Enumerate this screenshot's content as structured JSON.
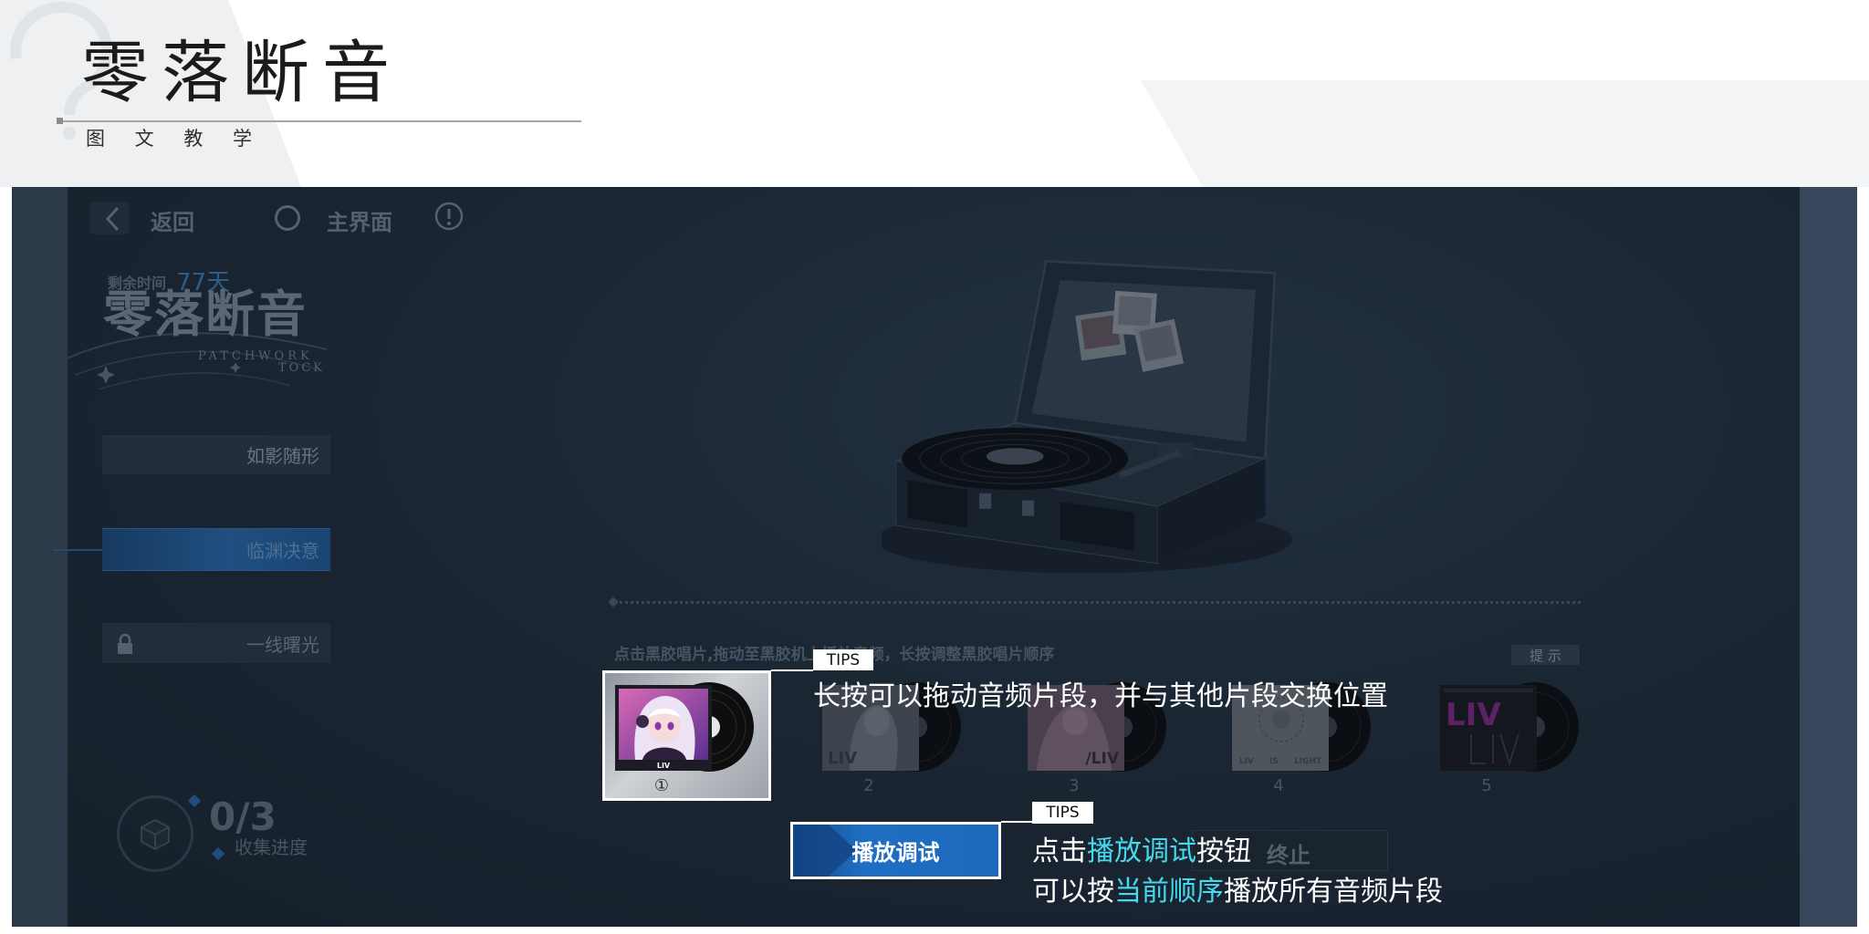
{
  "header": {
    "title": "零落断音",
    "subtitle": "图 文 教 学"
  },
  "game": {
    "nav": {
      "back_label": "返回",
      "home_label": "主界面"
    },
    "timer": {
      "label": "剩余时间",
      "value": "77天"
    },
    "logo": {
      "title": "零落断音",
      "sub1": "PATCHWORK",
      "sub2": "TOCK"
    },
    "menu": [
      {
        "label": "如影随形",
        "state": "normal"
      },
      {
        "label": "临渊决意",
        "state": "selected"
      },
      {
        "label": "一线曙光",
        "state": "locked"
      }
    ],
    "progress": {
      "value": "0/3",
      "label": "收集进度"
    },
    "instruction": "点击黑胶唱片,拖动至黑胶机上播放音频，长按调整黑胶唱片顺序",
    "hint_button": "提 示",
    "records": [
      {
        "number": "①",
        "cover_text": "LIV",
        "highlighted": true
      },
      {
        "number": "2",
        "cover_text": "LIV",
        "highlighted": false
      },
      {
        "number": "3",
        "cover_text": "/LIV",
        "highlighted": false
      },
      {
        "number": "4",
        "cover_text": "LIV IS LIGHT",
        "highlighted": false
      },
      {
        "number": "5",
        "cover_text": "LIV",
        "highlighted": false
      }
    ],
    "controls": {
      "play_debug": "播放调试",
      "stop": "终止"
    }
  },
  "tips": [
    {
      "tag": "TIPS",
      "text": "长按可以拖动音频片段，并与其他片段交换位置"
    },
    {
      "tag": "TIPS",
      "line1": [
        "点击",
        "播放调试",
        "按钮"
      ],
      "line2": [
        "可以按",
        "当前顺序",
        "播放所有音频片段"
      ]
    }
  ],
  "icons": {
    "background": "question-mark-icon",
    "back": "chevron-left-icon",
    "home": "circle-icon",
    "info": "info-icon",
    "lock": "lock-icon",
    "progress": "cube-icon"
  },
  "colors": {
    "tip_text": "#ffffff",
    "tip_highlight": "#45d9ee",
    "play_button": "#1f6fc4",
    "selected_menu": "#1f4f80",
    "timer_value": "#2c5d8a"
  }
}
